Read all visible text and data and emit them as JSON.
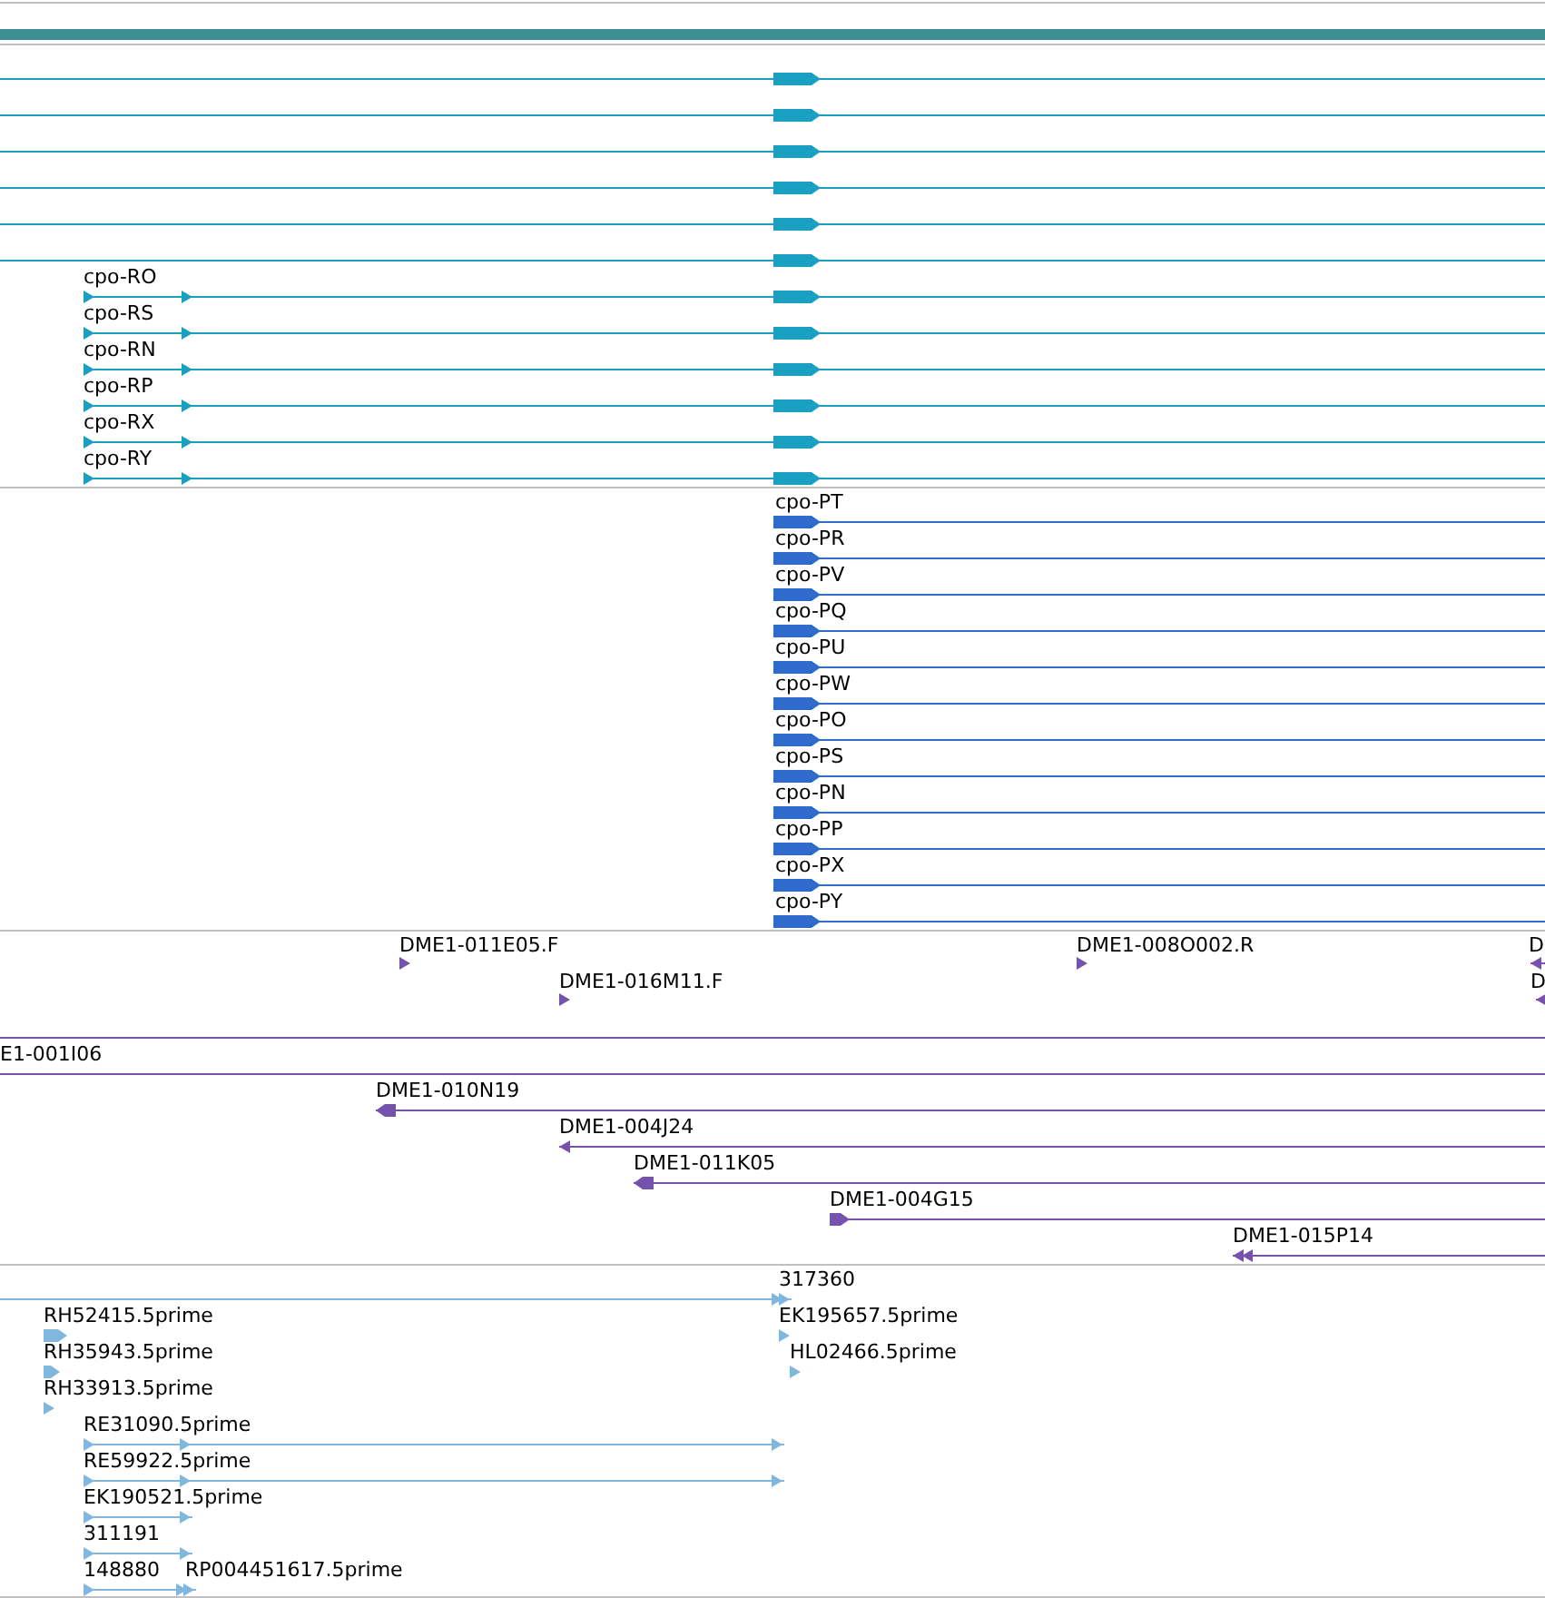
{
  "tracks": [
    {
      "kind": "gene_models",
      "features": [
        {
          "reverse": false
        },
        {
          "reverse": false
        },
        {
          "reverse": false
        },
        {
          "reverse": false
        },
        {
          "reverse": false
        },
        {
          "reverse": false
        },
        {
          "label": "cpo-RO",
          "reverse": false
        },
        {
          "label": "cpo-RS",
          "reverse": false
        },
        {
          "label": "cpo-RN",
          "reverse": false
        },
        {
          "label": "cpo-RP",
          "reverse": false
        },
        {
          "label": "cpo-RX",
          "reverse": false
        },
        {
          "label": "cpo-RY",
          "reverse": false
        }
      ]
    },
    {
      "kind": "transcripts",
      "features": [
        {
          "label": "cpo-PT",
          "reverse": false
        },
        {
          "label": "cpo-PR",
          "reverse": false
        },
        {
          "label": "cpo-PV",
          "reverse": false
        },
        {
          "label": "cpo-PQ",
          "reverse": false
        },
        {
          "label": "cpo-PU",
          "reverse": false
        },
        {
          "label": "cpo-PW",
          "reverse": false
        },
        {
          "label": "cpo-PO",
          "reverse": false
        },
        {
          "label": "cpo-PS",
          "reverse": false
        },
        {
          "label": "cpo-PN",
          "reverse": false
        },
        {
          "label": "cpo-PP",
          "reverse": false
        },
        {
          "label": "cpo-PX",
          "reverse": false
        },
        {
          "label": "cpo-PY",
          "reverse": false
        }
      ]
    },
    {
      "kind": "clones",
      "features": [
        {
          "label": "DME1-011E05.F",
          "reverse": false
        },
        {
          "label": "DME1-016M11.F",
          "reverse": false
        },
        {
          "label": "DME1-008O002.R",
          "reverse": false
        },
        {
          "label": "D",
          "reverse": true
        },
        {
          "label": "D",
          "reverse": true
        },
        {
          "label": "E1-001I06"
        },
        {
          "label": "DME1-010N19",
          "reverse": true
        },
        {
          "label": "DME1-004J24",
          "reverse": true
        },
        {
          "label": "DME1-011K05",
          "reverse": true
        },
        {
          "label": "DME1-004G15",
          "reverse": false
        },
        {
          "label": "DME1-015P14",
          "reverse": true
        }
      ]
    },
    {
      "kind": "ests",
      "features": [
        {
          "label": "317360",
          "reverse": false
        },
        {
          "label": "RH52415.5prime",
          "reverse": false
        },
        {
          "label": "RH35943.5prime",
          "reverse": false
        },
        {
          "label": "RH33913.5prime",
          "reverse": false
        },
        {
          "label": "EK195657.5prime",
          "reverse": false
        },
        {
          "label": "HL02466.5prime",
          "reverse": false
        },
        {
          "label": "RE31090.5prime",
          "reverse": false
        },
        {
          "label": "RE59922.5prime",
          "reverse": false
        },
        {
          "label": "EK190521.5prime",
          "reverse": false
        },
        {
          "label": "311191",
          "reverse": false
        },
        {
          "label": "148880",
          "reverse": false
        },
        {
          "label": "RP004451617.5prime"
        }
      ]
    }
  ]
}
